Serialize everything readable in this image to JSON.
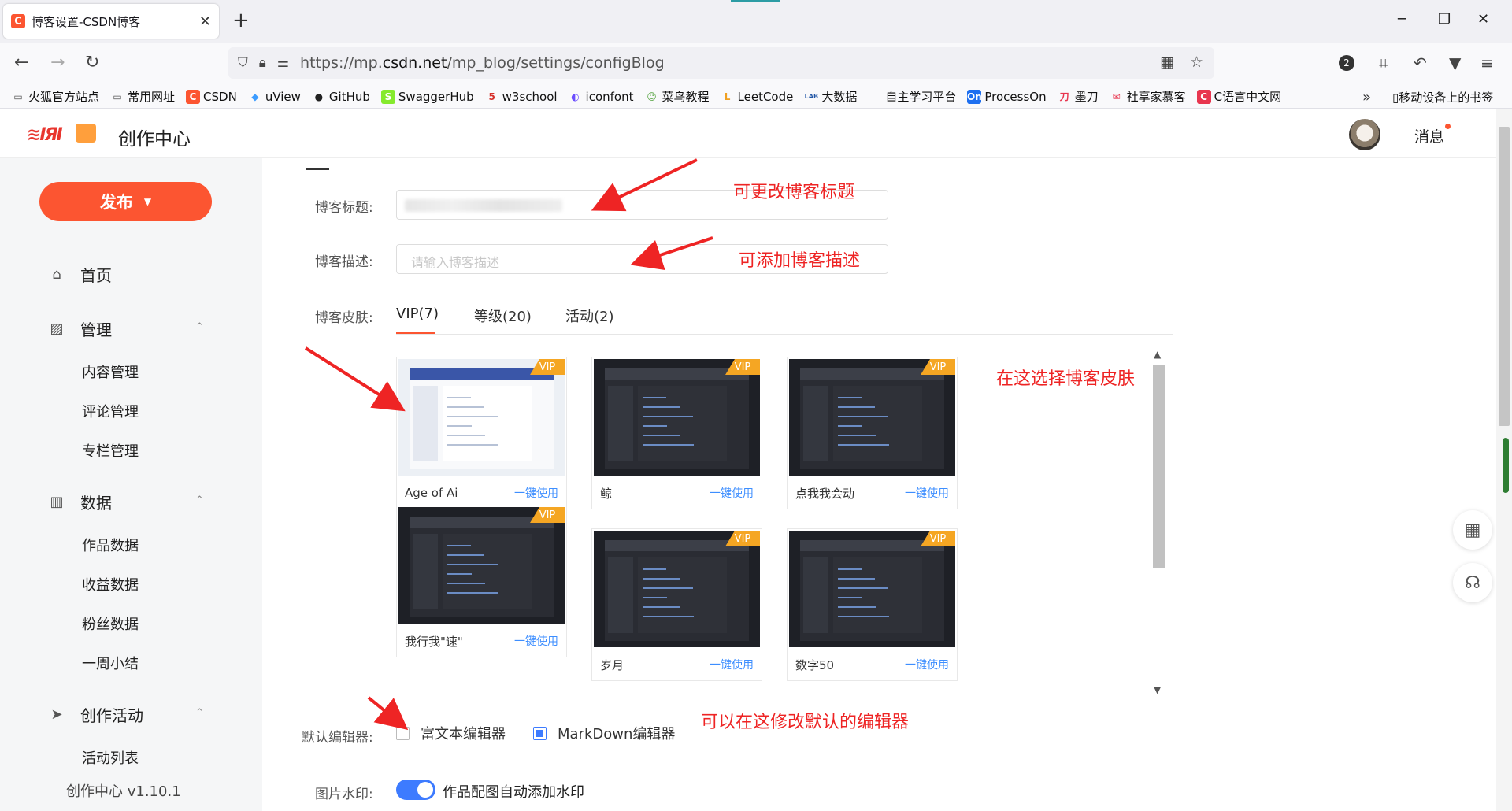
{
  "browser": {
    "tab_title": "博客设置-CSDN博客",
    "tab_close": "✕",
    "new_tab": "+",
    "url_prefix": "https://mp.",
    "url_host": "csdn.net",
    "url_path": "/mp_blog/settings/configBlog",
    "profile_badge": "2",
    "bookmarks": [
      {
        "label": "火狐官方站点",
        "icon": "folder-icon",
        "color": "#555555"
      },
      {
        "label": "常用网址",
        "icon": "folder-icon",
        "color": "#555555"
      },
      {
        "label": "CSDN",
        "icon": "csdn-icon",
        "color": "#fc5531"
      },
      {
        "label": "uView",
        "icon": "uview-icon",
        "color": "#3c9cff"
      },
      {
        "label": "GitHub",
        "icon": "github-icon",
        "color": "#222222"
      },
      {
        "label": "SwaggerHub",
        "icon": "swagger-icon",
        "color": "#85ea2d"
      },
      {
        "label": "w3school",
        "icon": "w3school-icon",
        "color": "#d6302a"
      },
      {
        "label": "iconfont",
        "icon": "iconfont-icon",
        "color": "#6b4eff"
      },
      {
        "label": "菜鸟教程",
        "icon": "runoob-icon",
        "color": "#5aa646"
      },
      {
        "label": "LeetCode",
        "icon": "leetcode-icon",
        "color": "#f0a020"
      },
      {
        "label": "大数据",
        "icon": "lab-icon",
        "color": "#2257a6"
      },
      {
        "label": "自主学习平台",
        "icon": "blank-icon",
        "color": "#ffffff"
      },
      {
        "label": "ProcessOn",
        "icon": "processon-icon",
        "color": "#1e6ff0"
      },
      {
        "label": "墨刀",
        "icon": "modao-icon",
        "color": "#e8364f"
      },
      {
        "label": "社享家慕客",
        "icon": "mail-icon",
        "color": "#e8364f"
      },
      {
        "label": "C语言中文网",
        "icon": "c-icon",
        "color": "#e8364f"
      }
    ],
    "bookmarks_more": "»",
    "mobile_bookmarks": "移动设备上的书签"
  },
  "header": {
    "brand": "创作中心",
    "message": "消息"
  },
  "sidebar": {
    "publish": "发布",
    "items": [
      {
        "label": "首页",
        "icon": "home-icon"
      },
      {
        "label": "管理",
        "icon": "chart-line-icon"
      },
      {
        "label": "内容管理"
      },
      {
        "label": "评论管理"
      },
      {
        "label": "专栏管理"
      },
      {
        "label": "数据",
        "icon": "bar-chart-icon"
      },
      {
        "label": "作品数据"
      },
      {
        "label": "收益数据"
      },
      {
        "label": "粉丝数据"
      },
      {
        "label": "一周小结"
      },
      {
        "label": "创作活动",
        "icon": "paper-plane-icon"
      },
      {
        "label": "活动列表"
      }
    ],
    "version": "创作中心 v1.10.1"
  },
  "form": {
    "title_label": "博客标题:",
    "desc_label": "博客描述:",
    "desc_placeholder": "请输入博客描述",
    "skin_label": "博客皮肤:",
    "skin_tabs": [
      "VIP(7)",
      "等级(20)",
      "活动(2)"
    ],
    "editor_label": "默认编辑器:",
    "editor_options": [
      "富文本编辑器",
      "MarkDown编辑器"
    ],
    "editor_selected": "MarkDown编辑器",
    "watermark_label": "图片水印:",
    "watermark_text": "作品配图自动添加水印",
    "watermark_on": true
  },
  "skins": [
    {
      "name": "Age of Ai",
      "badge": "VIP",
      "action": "一键使用",
      "theme": "light"
    },
    {
      "name": "鲸",
      "badge": "VIP",
      "action": "一键使用",
      "theme": "dark"
    },
    {
      "name": "点我我会动",
      "badge": "VIP",
      "action": "一键使用",
      "theme": "dark"
    },
    {
      "name": "我行我\"速\"",
      "badge": "VIP",
      "action": "一键使用",
      "theme": "dark"
    },
    {
      "name": "岁月",
      "badge": "VIP",
      "action": "一键使用",
      "theme": "dark"
    },
    {
      "name": "数字50",
      "badge": "VIP",
      "action": "一键使用",
      "theme": "dark"
    }
  ],
  "annotations": {
    "title": "可更改博客标题",
    "desc": "可添加博客描述",
    "skin": "在这选择博客皮肤",
    "editor": "可以在这修改默认的编辑器"
  },
  "colors": {
    "accent": "#fc5531",
    "link": "#3d8eff",
    "vip": "#f5a623",
    "annotation": "#ee2424"
  }
}
